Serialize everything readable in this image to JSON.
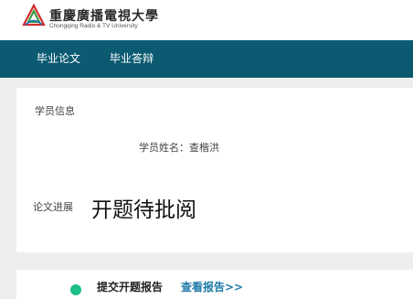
{
  "header": {
    "logo_cn": "重慶廣播電視大學",
    "logo_en": "Chongqing Radio & TV University"
  },
  "nav": {
    "items": [
      {
        "label": "毕业论文"
      },
      {
        "label": "毕业答辩"
      }
    ]
  },
  "student_info": {
    "section_title": "学员信息",
    "name_line": "学员姓名：查楷洪"
  },
  "thesis_progress": {
    "label": "论文进展",
    "status": "开题待批阅"
  },
  "report": {
    "label": "提交开题报告",
    "link": "查看报告>>",
    "dot_color": "#1cbf86"
  },
  "colors": {
    "nav_bg": "#0b5a72",
    "link": "#1e7aa8"
  }
}
